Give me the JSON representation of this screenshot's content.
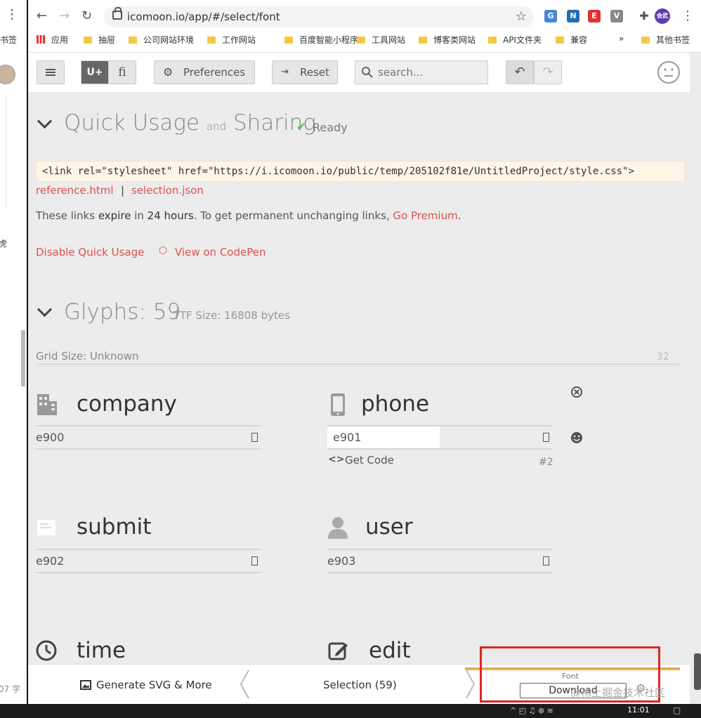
{
  "left_window": {
    "bookmark_fragment": "书签",
    "char_fragment": "虎",
    "status_fragment": "07 字"
  },
  "browser": {
    "url": "icomoon.io/app/#/select/font",
    "extensions": [
      {
        "name": "translate-icon",
        "color": "#4a86d8",
        "glyph": "G"
      },
      {
        "name": "n-extension-icon",
        "color": "#1f6fb6",
        "glyph": "N"
      },
      {
        "name": "e-extension-icon",
        "color": "#d33",
        "glyph": "E"
      },
      {
        "name": "v-extension-icon",
        "color": "#888",
        "glyph": "V"
      }
    ],
    "profile_label": "会武",
    "bookmarks": [
      {
        "label": "应用",
        "type": "apps"
      },
      {
        "label": "抽屉",
        "type": "folder"
      },
      {
        "label": "公司网站环境",
        "type": "folder"
      },
      {
        "label": "工作网站",
        "type": "folder"
      },
      {
        "label": "百度智能小程序",
        "type": "folder"
      },
      {
        "label": "工具网站",
        "type": "folder"
      },
      {
        "label": "博客类网站",
        "type": "folder"
      },
      {
        "label": "API文件夹",
        "type": "folder"
      },
      {
        "label": "兼容",
        "type": "folder"
      },
      {
        "label": "»",
        "type": "more"
      },
      {
        "label": "其他书签",
        "type": "folder"
      }
    ]
  },
  "toolbar": {
    "unicode_btn": "U+",
    "ligature_btn": "fi",
    "preferences": "Preferences",
    "reset": "Reset",
    "search_placeholder": "search..."
  },
  "quick_usage": {
    "title_a": "Quick Usage",
    "title_and": "and",
    "title_b": "Sharing",
    "status": "Ready",
    "link_code": "<link rel=\"stylesheet\" href=\"https://i.icomoon.io/public/temp/205102f81e/UntitledProject/style.css\">",
    "reference_link": "reference.html",
    "separator": "|",
    "selection_link": "selection.json",
    "note_prefix": "These links ",
    "note_expire": "expire",
    "note_in": " in ",
    "note_hours": "24 hours",
    "note_suffix": ". To get permanent unchanging links, ",
    "premium": "Go Premium",
    "period": ".",
    "disable": "Disable Quick Usage",
    "codepen": "View on CodePen"
  },
  "glyphs": {
    "title": "Glyphs: 59",
    "ttf": "TTF Size: 16808 bytes",
    "grid": "Grid Size: Unknown",
    "grid_size_value": "32",
    "items": [
      {
        "name": "company",
        "code": "e900"
      },
      {
        "name": "phone",
        "code": "e901",
        "get_code": "Get Code",
        "index": "#2"
      },
      {
        "name": "submit",
        "code": "e902"
      },
      {
        "name": "user",
        "code": "e903"
      },
      {
        "name": "time",
        "code": ""
      },
      {
        "name": "edit",
        "code": ""
      }
    ]
  },
  "footer": {
    "generate": "Generate SVG & More",
    "selection": "Selection (59)",
    "font_label": "Font",
    "download": "Download"
  },
  "watermark": "@稀土掘金技术社区",
  "taskbar": {
    "time": "11:01"
  },
  "colors": {
    "accent_red": "#d9534f",
    "highlight_box": "#e02424",
    "progress_orange": "#f0ad4e",
    "ready_green": "#5cb85c"
  }
}
